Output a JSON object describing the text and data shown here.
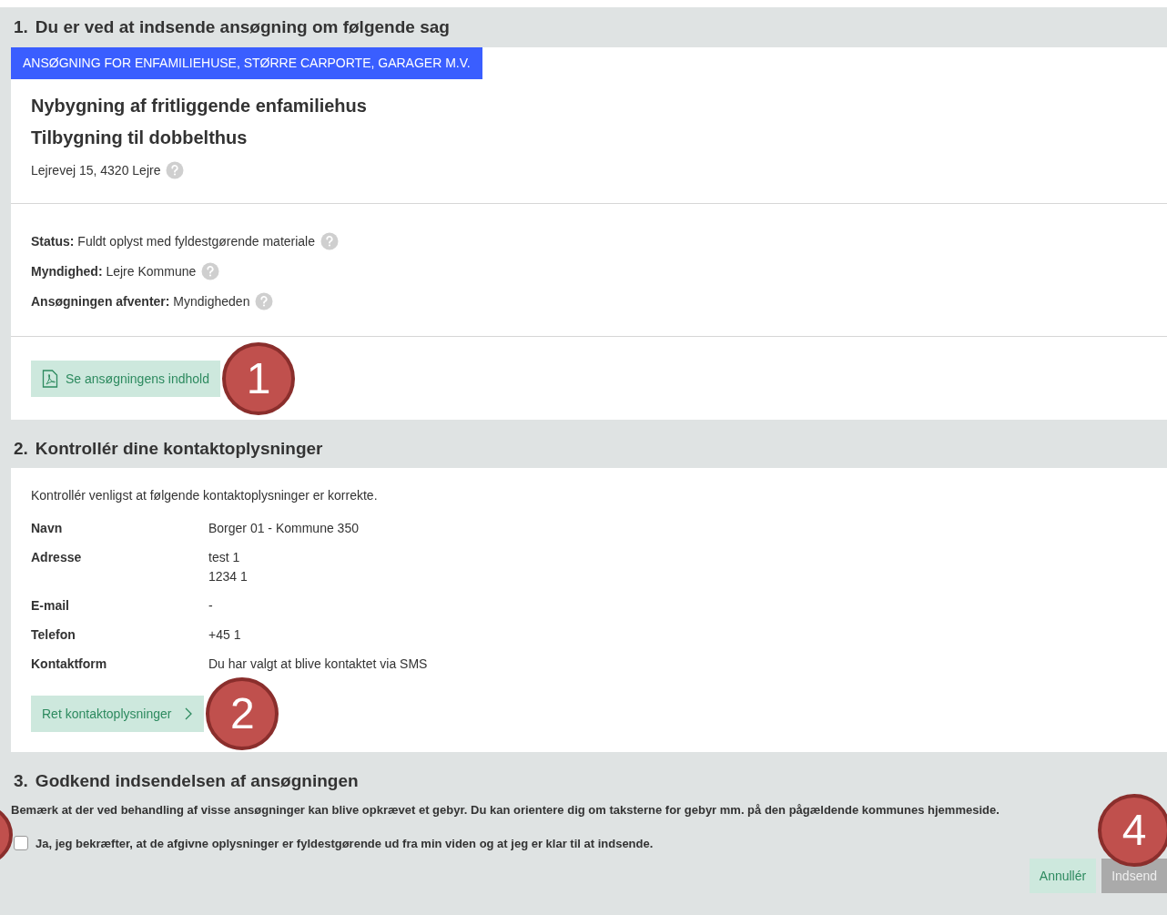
{
  "application": {
    "number": "1.",
    "title": "Du er ved at indsende ansøgning om følgende sag",
    "category": "ANSØGNING FOR ENFAMILIEHUSE, STØRRE CARPORTE, GARAGER M.V.",
    "headings": [
      "Nybygning af fritliggende enfamiliehus",
      "Tilbygning til dobbelthus"
    ],
    "address": "Lejrevej 15, 4320 Lejre",
    "facts": [
      {
        "label": "Status:",
        "value": "Fuldt oplyst med fyldestgørende materiale"
      },
      {
        "label": "Myndighed:",
        "value": "Lejre Kommune"
      },
      {
        "label": "Ansøgningen afventer:",
        "value": "Myndigheden"
      }
    ],
    "button": "Se ansøgningens indhold",
    "callout": "1"
  },
  "contact": {
    "number": "2.",
    "title": "Kontrollér dine kontaktoplysninger",
    "intro": "Kontrollér venligst at følgende kontaktoplysninger er korrekte.",
    "rows": [
      {
        "label": "Navn",
        "lines": [
          "Borger 01 - Kommune 350"
        ]
      },
      {
        "label": "Adresse",
        "lines": [
          "test 1",
          "1234 1"
        ]
      },
      {
        "label": "E-mail",
        "lines": [
          "-"
        ]
      },
      {
        "label": "Telefon",
        "lines": [
          "+45 1"
        ]
      },
      {
        "label": "Kontaktform",
        "lines": [
          "Du har valgt at blive kontaktet via SMS"
        ]
      }
    ],
    "button": "Ret kontaktoplysninger",
    "callout": "2"
  },
  "approval": {
    "number": "3.",
    "title": "Godkend indsendelsen af ansøgningen",
    "note": "Bemærk at der ved behandling af visse ansøgninger kan blive opkrævet et gebyr. Du kan orientere dig om taksterne for gebyr mm. på den pågældende kommunes hjemmeside.",
    "confirm": {
      "label": "Ja, jeg bekræfter, at de afgivne oplysninger er fyldestgørende ud fra min viden og at jeg er klar til at indsende.",
      "checked": false
    },
    "edge_callout": true,
    "buttons": [
      {
        "label": "Annullér",
        "kind": "secondary",
        "disabled": false
      },
      {
        "label": "Indsend",
        "kind": "primary",
        "disabled": true
      }
    ],
    "callout": "4"
  }
}
